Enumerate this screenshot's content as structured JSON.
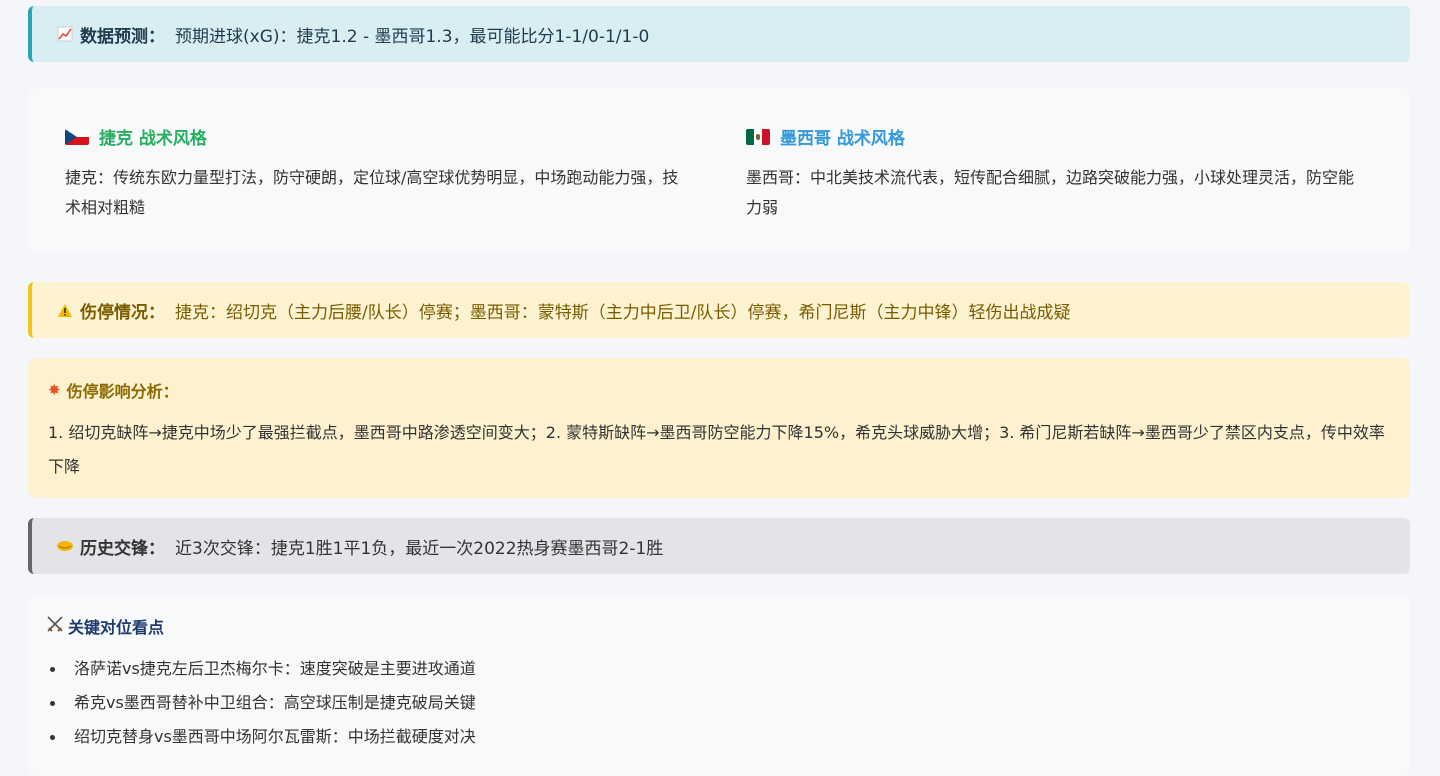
{
  "prediction": {
    "icon": "chart-up-icon",
    "label": "数据预测：",
    "text": "预期进球(xG)：捷克1.2 - 墨西哥1.3，最可能比分1-1/0-1/1-0"
  },
  "styles": {
    "czech": {
      "flag": "czech-flag-icon",
      "title": "捷克 战术风格",
      "desc": "捷克：传统东欧力量型打法，防守硬朗，定位球/高空球优势明显，中场跑动能力强，技术相对粗糙"
    },
    "mexico": {
      "flag": "mexico-flag-icon",
      "title": "墨西哥 战术风格",
      "desc": "墨西哥：中北美技术流代表，短传配合细腻，边路突破能力强，小球处理灵活，防空能力弱"
    }
  },
  "injury": {
    "icon": "warning-icon",
    "label": "伤停情况：",
    "text": "捷克：绍切克（主力后腰/队长）停赛；墨西哥：蒙特斯（主力中后卫/队长）停赛，希门尼斯（主力中锋）轻伤出战成疑"
  },
  "impact": {
    "icon": "collision-icon",
    "title": "伤停影响分析：",
    "text": "1. 绍切克缺阵→捷克中场少了最强拦截点，墨西哥中路渗透空间变大；2. 蒙特斯缺阵→墨西哥防空能力下降15%，希克头球威胁大增；3. 希门尼斯若缺阵→墨西哥少了禁区内支点，传中效率下降"
  },
  "history": {
    "icon": "handshake-icon",
    "label": "历史交锋：",
    "text": "近3次交锋：捷克1胜1平1负，最近一次2022热身赛墨西哥2-1胜"
  },
  "matchups": {
    "icon": "crossed-swords-icon",
    "title": "关键对位看点",
    "items": [
      "洛萨诺vs捷克左后卫杰梅尔卡：速度突破是主要进攻通道",
      "希克vs墨西哥替补中卫组合：高空球压制是捷克破局关键",
      "绍切克替身vs墨西哥中场阿尔瓦雷斯：中场拦截硬度对决"
    ]
  },
  "colors": {
    "prediction_accent": "#26a7bd",
    "czech_title": "#27ae60",
    "mexico_title": "#3498db",
    "injury_accent": "#f0c419",
    "history_accent": "#666666"
  }
}
